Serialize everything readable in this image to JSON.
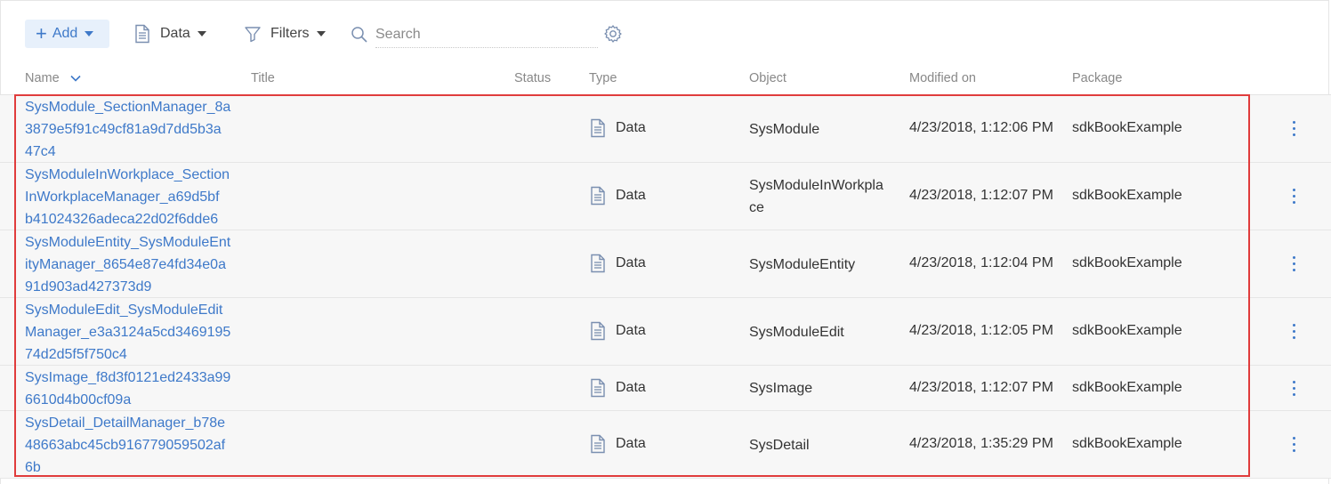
{
  "toolbar": {
    "add_label": "Add",
    "data_label": "Data",
    "filters_label": "Filters",
    "search_placeholder": "Search",
    "accent_color": "#3e79c9"
  },
  "columns": {
    "name": "Name",
    "title": "Title",
    "status": "Status",
    "type": "Type",
    "object": "Object",
    "modified_on": "Modified on",
    "package": "Package"
  },
  "rows": [
    {
      "name_lines": [
        "SysModule_SectionManager_8a",
        "3879e5f91c49cf81a9d7dd5b3a",
        "47c4"
      ],
      "type": "Data",
      "object_lines": [
        "SysModule"
      ],
      "modified": "4/23/2018, 1:12:06 PM",
      "package": "sdkBookExample"
    },
    {
      "name_lines": [
        "SysModuleInWorkplace_Section",
        "InWorkplaceManager_a69d5bf",
        "b41024326adeca22d02f6dde6"
      ],
      "type": "Data",
      "object_lines": [
        "SysModuleInWorkpla",
        "ce"
      ],
      "modified": "4/23/2018, 1:12:07 PM",
      "package": "sdkBookExample"
    },
    {
      "name_lines": [
        "SysModuleEntity_SysModuleEnt",
        "ityManager_8654e87e4fd34e0a",
        "91d903ad427373d9"
      ],
      "type": "Data",
      "object_lines": [
        "SysModuleEntity"
      ],
      "modified": "4/23/2018, 1:12:04 PM",
      "package": "sdkBookExample"
    },
    {
      "name_lines": [
        "SysModuleEdit_SysModuleEdit",
        "Manager_e3a3124a5cd3469195",
        "74d2d5f5f750c4"
      ],
      "type": "Data",
      "object_lines": [
        "SysModuleEdit"
      ],
      "modified": "4/23/2018, 1:12:05 PM",
      "package": "sdkBookExample"
    },
    {
      "name_lines": [
        "SysImage_f8d3f0121ed2433a99",
        "6610d4b00cf09a"
      ],
      "type": "Data",
      "object_lines": [
        "SysImage"
      ],
      "modified": "4/23/2018, 1:12:07 PM",
      "package": "sdkBookExample"
    },
    {
      "name_lines": [
        "SysDetail_DetailManager_b78e",
        "48663abc45cb916779059502af",
        "6b"
      ],
      "type": "Data",
      "object_lines": [
        "SysDetail"
      ],
      "modified": "4/23/2018, 1:35:29 PM",
      "package": "sdkBookExample"
    }
  ]
}
